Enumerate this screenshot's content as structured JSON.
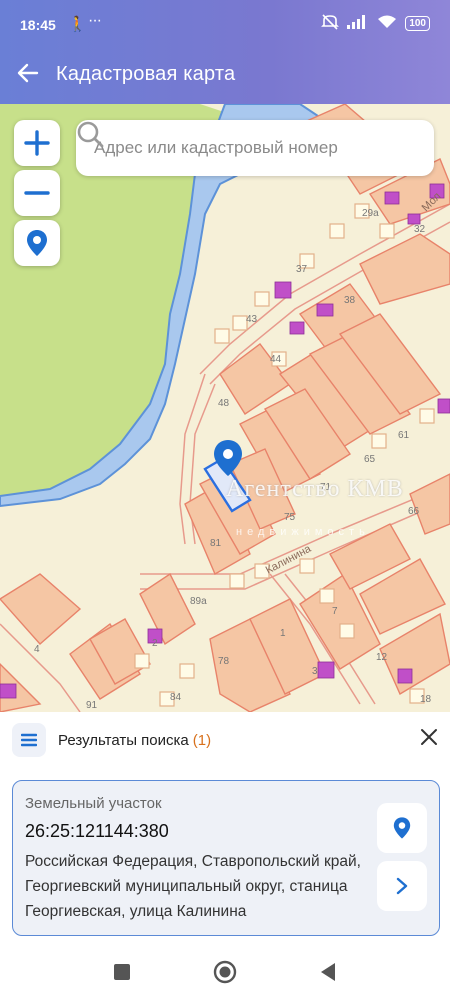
{
  "status_bar": {
    "time": "18:45",
    "battery": "100",
    "icons": [
      "walk-icon",
      "more-dots-icon",
      "mute-icon",
      "signal-icon",
      "wifi-icon",
      "battery-icon"
    ]
  },
  "app_bar": {
    "title": "Кадастровая карта"
  },
  "search": {
    "placeholder": "Адрес или кадастровый номер"
  },
  "map": {
    "labels": {
      "l37": "37",
      "l38": "38",
      "l43": "43",
      "l44": "44",
      "l48": "48",
      "l61": "61",
      "l65": "65",
      "l71": "71",
      "l75": "75",
      "l81": "81",
      "l89a": "89а",
      "l66": "66",
      "l32": "32",
      "l29a": "29а",
      "l4": "4",
      "l78": "78",
      "l1": "1",
      "l3": "3",
      "l12": "12",
      "l84": "84",
      "l91": "91",
      "l18": "18",
      "l2": "2",
      "l7": "7",
      "street_kalinina": "Калинина",
      "street_mol": "Мол"
    },
    "watermark": "Агентство КМВ",
    "watermark_sub": "недвижимость"
  },
  "results": {
    "header_label": "Результаты поиска",
    "count": "(1)"
  },
  "result_card": {
    "type": "Земельный участок",
    "cadastral_number": "26:25:121144:380",
    "address": "Российская Федерация, Ставропольский край, Георгиевский муниципальный округ, станица Георгиевская, улица Калинина"
  },
  "colors": {
    "accent": "#1e6fd0",
    "header": "#7a7fd4",
    "parcel": "#f5c6a4",
    "parcel_border": "#e8836a",
    "building": "#c04fc8",
    "river": "#a9c8ee",
    "green": "#c7e08a",
    "count": "#d8711c"
  }
}
